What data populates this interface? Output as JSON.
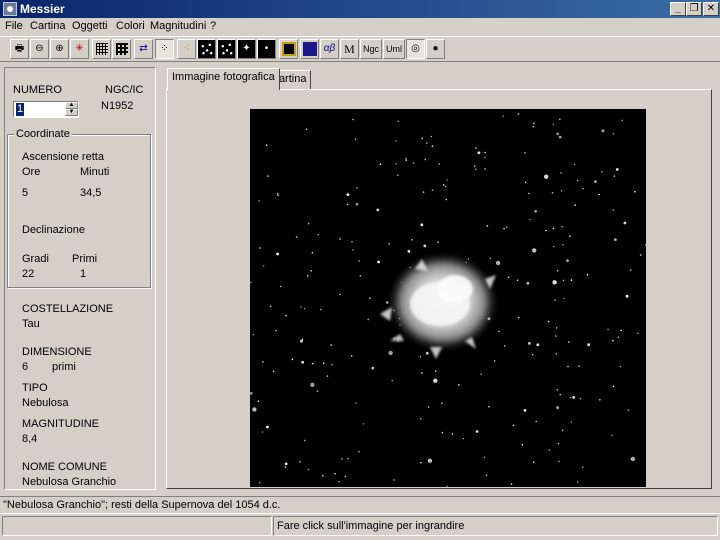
{
  "window": {
    "title": "Messier",
    "minimize_label": "_",
    "maximize_label": "❐",
    "close_label": "✕"
  },
  "menu": [
    "File",
    "Cartina",
    "Oggetti",
    "Colori",
    "Magnitudini",
    "?"
  ],
  "toolbar": {
    "alpha_beta_label": "αβ",
    "m_label": "M",
    "ngc_label": "Ngc",
    "uml_label": "Uml"
  },
  "left": {
    "numero_label": "NUMERO",
    "numero_value": "1",
    "ngc_label": "NGC/IC",
    "ngc_value": "N1952",
    "coord_title": "Coordinate",
    "ra_label": "Ascensione retta",
    "ore_label": "Ore",
    "minuti_label": "Minuti",
    "ore_value": "5",
    "minuti_value": "34,5",
    "dec_label": "Declinazione",
    "gradi_label": "Gradi",
    "primi_label": "Primi",
    "gradi_value": "22",
    "primi_value": "1",
    "costellazione_label": "COSTELLAZIONE",
    "costellazione_value": "Tau",
    "dimensione_label": "DIMENSIONE",
    "dimensione_value": "6",
    "dimensione_unit": "primi",
    "tipo_label": "TIPO",
    "tipo_value": "Nebulosa",
    "magnitudine_label": "MAGNITUDINE",
    "magnitudine_value": "8,4",
    "nome_label": "NOME COMUNE",
    "nome_value": "Nebulosa Granchio"
  },
  "tabs": [
    "Immagine fotografica",
    "Cartina"
  ],
  "status": {
    "description": "\"Nebulosa Granchio\"; resti della Supernova del 1054 d.c.",
    "hint": "Fare click sull'immagine per ingrandire"
  }
}
